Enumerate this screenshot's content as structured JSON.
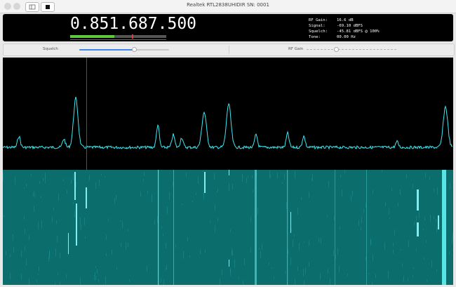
{
  "window": {
    "title": "Realtek RTL2838UHIDIR SN: 0001"
  },
  "display": {
    "frequency": "0.851.687.500",
    "signal_level_fraction": 0.46,
    "squelch_marker_fraction": 0.64,
    "stats": [
      {
        "label": "RF Gain:",
        "value": "16.6 dB"
      },
      {
        "label": "Signal:",
        "value": "-69.10 dBFS"
      },
      {
        "label": "Squelch:",
        "value": "-45.81 dBFS @ 100%"
      },
      {
        "label": "Tone:",
        "value": "00.00 Hz"
      }
    ]
  },
  "controls": {
    "squelch": {
      "label": "Squelch",
      "value_fraction": 0.61
    },
    "rf_gain": {
      "label": "RF Gain",
      "value_fraction": 0.33
    }
  },
  "colors": {
    "spectrum_trace": "#3ee7f0",
    "waterfall_bg": "#0c6d6d",
    "cursor": "#c3201f",
    "signal_bar": "#5ec93a",
    "slider_accent": "#3f86f1"
  }
}
